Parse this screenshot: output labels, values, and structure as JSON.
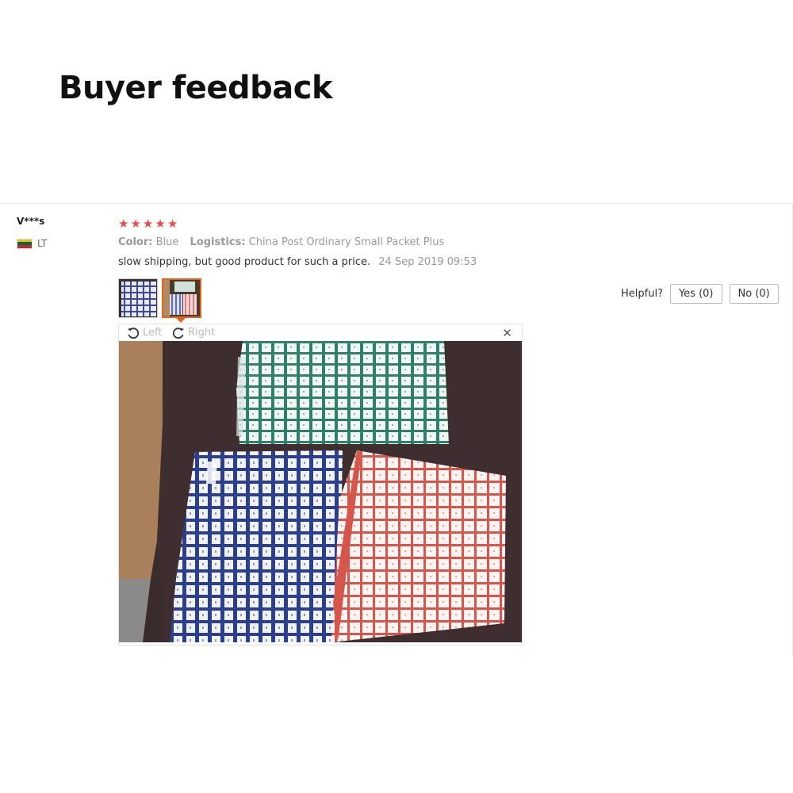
{
  "page": {
    "title": "Buyer feedback"
  },
  "buyer": {
    "name": "V***s",
    "country_code": "LT",
    "flag_colors": [
      "#fdb913",
      "#006a44",
      "#c1272d"
    ]
  },
  "review": {
    "rating": 5,
    "star_color": "#f04848",
    "attributes": [
      {
        "key": "Color:",
        "value": "Blue"
      },
      {
        "key": "Logistics:",
        "value": "China Post Ordinary Small Packet Plus"
      }
    ],
    "comment": "slow shipping, but good product for such a price.",
    "date": "24 Sep 2019 09:53",
    "thumbnails": [
      {
        "name": "photo-1",
        "active": false
      },
      {
        "name": "photo-2",
        "active": true
      }
    ],
    "active_color": "#e6631a"
  },
  "helpful": {
    "label": "Helpful?",
    "yes": "Yes (0)",
    "no": "No (0)"
  },
  "viewer": {
    "rotate_left": "Left",
    "rotate_right": "Right",
    "close_icon": "close-icon"
  }
}
